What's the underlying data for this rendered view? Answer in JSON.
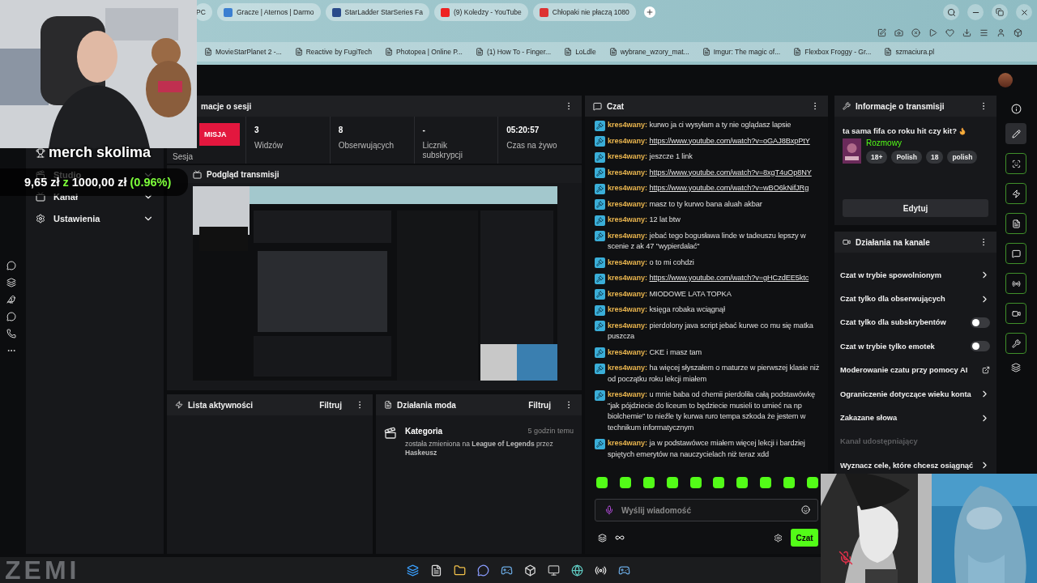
{
  "browser": {
    "tabs": [
      {
        "label": "PC",
        "selected": false
      },
      {
        "label": "Gracze | Aternos | Darmo",
        "selected": false
      },
      {
        "label": "StarLadder StarSeries Fa",
        "selected": false
      },
      {
        "label": "(9) Koledzy - YouTube",
        "selected": false
      },
      {
        "label": "Chłopaki nie płaczą 1080",
        "selected": false
      }
    ],
    "bookmarks": [
      "MovieStarPlanet 2 -...",
      "Reactive by FugiTech",
      "Photopea | Online P...",
      "(1) How To - Finger...",
      "LoLdle",
      "wybrane_wzory_mat...",
      "Imgur: The magic of...",
      "Flexbox Froggy - Gr...",
      "szmaciura.pl"
    ]
  },
  "goal_overlay": {
    "title": "merch skolima",
    "current": "9,65 zł",
    "separator": "z",
    "target": "1000,00 zł",
    "percent": "(0.96%)"
  },
  "sidebar": {
    "items": [
      {
        "label": "Studio",
        "expanded": false
      },
      {
        "label": "Kanał",
        "expanded": false
      },
      {
        "label": "Ustawienia",
        "expanded": false
      }
    ]
  },
  "session": {
    "title": "macje o sesji",
    "button": "MISJA",
    "label": "Sesja",
    "stats": [
      {
        "value": "3",
        "label": "Widzów"
      },
      {
        "value": "8",
        "label": "Obserwujących"
      },
      {
        "value": "-",
        "label": "Licznik subskrypcji"
      },
      {
        "value": "05:20:57",
        "label": "Czas na żywo"
      }
    ]
  },
  "preview": {
    "title": "Podgląd transmisji"
  },
  "activity": {
    "title": "Lista aktywności",
    "filter": "Filtruj"
  },
  "mod_actions": {
    "title": "Działania moda",
    "filter": "Filtruj",
    "entries": [
      {
        "title": "Kategoria",
        "time": "5 godzin temu",
        "text": "została zmieniona na **League of Legends** przez **Haskeusz**"
      }
    ]
  },
  "chat": {
    "title": "Czat",
    "messages": [
      {
        "user": "kres4wany:",
        "kind": "text",
        "text": "kurwo ja ci wysyłam a ty nie oglądasz lapsie"
      },
      {
        "user": "kres4wany:",
        "kind": "link",
        "text": "https://www.youtube.com/watch?v=oGAJ8BxpPtY"
      },
      {
        "user": "kres4wany:",
        "kind": "text",
        "text": "jeszcze 1 link"
      },
      {
        "user": "kres4wany:",
        "kind": "link",
        "text": "https://www.youtube.com/watch?v=8xgT4uOp8NY"
      },
      {
        "user": "kres4wany:",
        "kind": "link",
        "text": "https://www.youtube.com/watch?v=wBO6kNifJRg"
      },
      {
        "user": "kres4wany:",
        "kind": "text",
        "text": "masz to ty kurwo bana aluah akbar"
      },
      {
        "user": "kres4wany:",
        "kind": "text",
        "text": "12 lat btw"
      },
      {
        "user": "kres4wany:",
        "kind": "text",
        "text": "jebać tego bogusława linde w tadeuszu lepszy w scenie z ak 47 \"wypierdalać\""
      },
      {
        "user": "kres4wany:",
        "kind": "text",
        "text": "o to mi cohdzi"
      },
      {
        "user": "kres4wany:",
        "kind": "link",
        "text": "https://www.youtube.com/watch?v=gHCzdEE5ktc"
      },
      {
        "user": "kres4wany:",
        "kind": "text",
        "text": "MIODOWE LATA TOPKA"
      },
      {
        "user": "kres4wany:",
        "kind": "text",
        "text": "księga robaka wciągnął"
      },
      {
        "user": "kres4wany:",
        "kind": "text",
        "text": "pierdolony java script jebać kurwe co mu się matka puszcza"
      },
      {
        "user": "kres4wany:",
        "kind": "text",
        "text": "CKE i masz tam"
      },
      {
        "user": "kres4wany:",
        "kind": "text",
        "text": "ha więcej słyszałem o maturze w pierwszej klasie niż od początku roku lekcji miałem"
      },
      {
        "user": "kres4wany:",
        "kind": "text",
        "text": "u mnie baba od chemii pierdoliła całą podstawówkę \"jak pójdziecie do liceum to będziecie musieli to umieć na np biolchemie\" to nieźle ty kurwa ruro tempa szkoda że jestem w technikum informatycznym"
      },
      {
        "user": "kres4wany:",
        "kind": "text",
        "text": "ja w podstawówce miałem więcej lekcji i bardziej spiętych emerytów na nauczycielach niż teraz xdd"
      }
    ],
    "placeholder": "Wyślij wiadomość",
    "send": "Czat"
  },
  "stream_info": {
    "title": "Informacje o transmisji",
    "stream_title": "ta sama fifa co roku hit czy kit?",
    "category": "Rozmowy",
    "tags": [
      "18+",
      "Polish",
      "18",
      "polish"
    ],
    "edit": "Edytuj"
  },
  "channel_actions": {
    "title": "Działania na kanale",
    "items": [
      {
        "label": "Czat w trybie spowolnionym",
        "kind": "arrow"
      },
      {
        "label": "Czat tylko dla obserwujących",
        "kind": "arrow"
      },
      {
        "label": "Czat tylko dla subskrybentów",
        "kind": "toggle",
        "on": false
      },
      {
        "label": "Czat w trybie tylko emotek",
        "kind": "toggle",
        "on": false
      },
      {
        "label": "Moderowanie czatu przy pomocy AI",
        "kind": "external"
      },
      {
        "label": "Ograniczenie dotyczące wieku konta",
        "kind": "arrow"
      },
      {
        "label": "Zakazane słowa",
        "kind": "arrow"
      },
      {
        "label": "Kanał udostępniający",
        "kind": "label"
      },
      {
        "label": "Wyznacz cele, które chcesz osiągnąć",
        "kind": "arrow"
      }
    ]
  },
  "taskbar": {
    "wallpaper_text": "ZEMI"
  }
}
